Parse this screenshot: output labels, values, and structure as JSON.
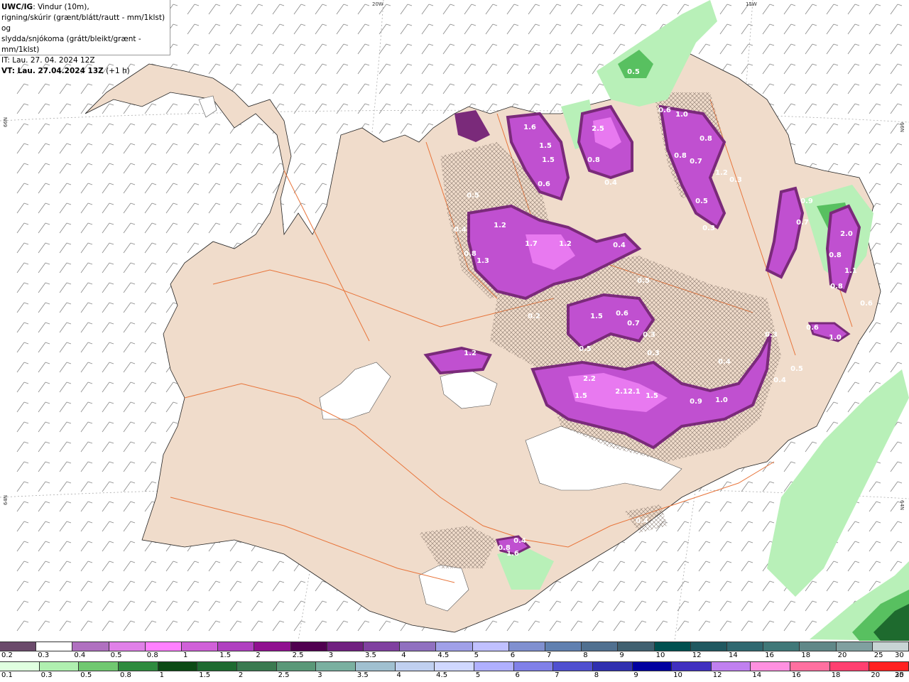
{
  "header": {
    "model": "UWC/IG",
    "line1_rest": ": Vindur (10m),",
    "line2": "rigning/skúrir (grænt/blátt/rautt - mm/1klst) og",
    "line3": "slydda/snjókoma (grátt/bleikt/grænt - mm/1klst)",
    "issue_time": "IT: Lau. 27. 04. 2024 12Z",
    "valid_prefix": "VT: Lau. 27.04.2024 13Z",
    "valid_offset": " (+1 h)"
  },
  "grid_labels": {
    "lon_20w": "20W",
    "lon_15w": "15W",
    "lat_66n_left": "66N",
    "lat_66n_right": "66N",
    "lat_64n_left": "64N",
    "lat_64n_right": "64N"
  },
  "colors": {
    "land": "#f0dccb",
    "sea": "#ffffff",
    "roads": "#e8743a",
    "snow_purple_light": "#e879f0",
    "snow_purple_mid": "#c050d0",
    "snow_purple_dark": "#7a2a7a",
    "rain_green_light": "#b8f0b8",
    "rain_green_mid": "#58c060",
    "rain_green_dark": "#1e6a2e"
  },
  "precip_labels": [
    {
      "text": "0.5",
      "id": "a"
    },
    {
      "text": "1.6",
      "id": "b"
    },
    {
      "text": "1.5",
      "id": "c"
    },
    {
      "text": "1.5",
      "id": "d"
    },
    {
      "text": "0.6",
      "id": "e"
    },
    {
      "text": "2.5",
      "id": "f"
    },
    {
      "text": "0.8",
      "id": "g"
    },
    {
      "text": "0.4",
      "id": "h"
    },
    {
      "text": "0.6",
      "id": "i"
    },
    {
      "text": "1.0",
      "id": "j"
    },
    {
      "text": "0.8",
      "id": "k"
    },
    {
      "text": "0.8",
      "id": "l"
    },
    {
      "text": "0.7",
      "id": "m"
    },
    {
      "text": "1.2",
      "id": "n"
    },
    {
      "text": "0.3",
      "id": "o"
    },
    {
      "text": "0.5",
      "id": "p"
    },
    {
      "text": "0.3",
      "id": "q"
    },
    {
      "text": "0.9",
      "id": "r"
    },
    {
      "text": "0.7",
      "id": "s"
    },
    {
      "text": "2.0",
      "id": "t"
    },
    {
      "text": "0.8",
      "id": "u"
    },
    {
      "text": "1.1",
      "id": "v"
    },
    {
      "text": "0.8",
      "id": "w"
    },
    {
      "text": "1.2",
      "id": "x"
    },
    {
      "text": "1.7",
      "id": "y"
    },
    {
      "text": "1.2",
      "id": "z"
    },
    {
      "text": "0.4",
      "id": "aa"
    },
    {
      "text": "0.8",
      "id": "ab"
    },
    {
      "text": "1.3",
      "id": "ac"
    },
    {
      "text": "1.5",
      "id": "ad"
    },
    {
      "text": "0.6",
      "id": "ae"
    },
    {
      "text": "0.7",
      "id": "af"
    },
    {
      "text": "0.3",
      "id": "ag"
    },
    {
      "text": "0.5",
      "id": "ah"
    },
    {
      "text": "0.3",
      "id": "ai"
    },
    {
      "text": "1.2",
      "id": "aj"
    },
    {
      "text": "2.2",
      "id": "ak"
    },
    {
      "text": "1.5",
      "id": "al"
    },
    {
      "text": "2.12.1",
      "id": "am"
    },
    {
      "text": "1.5",
      "id": "an"
    },
    {
      "text": "0.9",
      "id": "ao"
    },
    {
      "text": "1.0",
      "id": "ap"
    },
    {
      "text": "0.4",
      "id": "aq"
    },
    {
      "text": "0.5",
      "id": "ar"
    },
    {
      "text": "0.4",
      "id": "as"
    },
    {
      "text": "0.6",
      "id": "at"
    },
    {
      "text": "1.0",
      "id": "au"
    },
    {
      "text": "0.4",
      "id": "av"
    },
    {
      "text": "0.8",
      "id": "aw"
    },
    {
      "text": "1.6",
      "id": "ax"
    },
    {
      "text": "0.4",
      "id": "ay"
    },
    {
      "text": "0.5",
      "id": "az"
    },
    {
      "text": "0.2",
      "id": "ba"
    },
    {
      "text": "0.5",
      "id": "bb"
    },
    {
      "text": "0.3",
      "id": "bc"
    },
    {
      "text": "0.4",
      "id": "bd"
    },
    {
      "text": "0.6",
      "id": "be"
    }
  ],
  "legend_snow": {
    "colors": [
      "#6b4a6b",
      "#ffffff",
      "#b070c0",
      "#e080e8",
      "#ff80ff",
      "#d060d8",
      "#b040c0",
      "#901090",
      "#500050",
      "#702080",
      "#8040a0",
      "#9070c0",
      "#a0a0e8",
      "#c0c0ff",
      "#8090d0",
      "#6080b0",
      "#507090",
      "#406070",
      "#005050",
      "#205860",
      "#306870",
      "#407878",
      "#608888",
      "#80a0a0",
      "#c8d4d4"
    ],
    "labels": [
      "0.2",
      "0.3",
      "0.4",
      "0.5",
      "0.8",
      "1",
      "1.5",
      "2",
      "2.5",
      "3",
      "3.5",
      "4",
      "4.5",
      "5",
      "6",
      "7",
      "8",
      "9",
      "10",
      "12",
      "14",
      "16",
      "18",
      "20",
      "25",
      "30"
    ]
  },
  "legend_rain": {
    "colors": [
      "#e0ffe0",
      "#b0f0b0",
      "#70c870",
      "#2e8b3e",
      "#0c4a14",
      "#1e6a30",
      "#3a7a50",
      "#5a9878",
      "#7ab0a0",
      "#a0c0d0",
      "#c0d0f0",
      "#d0d8ff",
      "#b0b0ff",
      "#8080e8",
      "#5050d0",
      "#3030b0",
      "#0000a0",
      "#4030c0",
      "#c080f0",
      "#ff90e0",
      "#ff70a0",
      "#ff4070",
      "#ff2020"
    ],
    "labels": [
      "0.1",
      "0.3",
      "0.5",
      "0.8",
      "1",
      "1.5",
      "2",
      "2.5",
      "3",
      "3.5",
      "4",
      "4.5",
      "5",
      "6",
      "7",
      "8",
      "9",
      "10",
      "12",
      "14",
      "16",
      "18",
      "20",
      "25",
      "30"
    ]
  }
}
